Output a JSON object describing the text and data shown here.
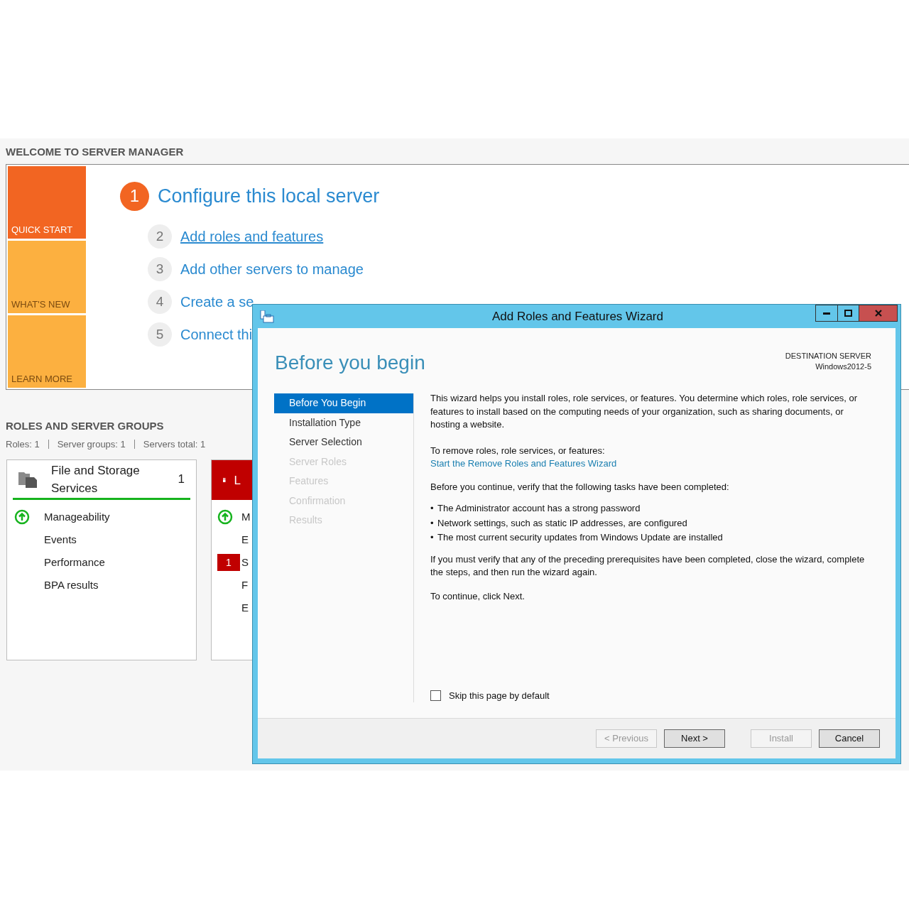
{
  "page_heading": "WELCOME TO SERVER MANAGER",
  "quick_start": {
    "tiles": [
      {
        "label": "QUICK START",
        "selected": true
      },
      {
        "label": "WHAT'S NEW",
        "selected": false
      },
      {
        "label": "LEARN MORE",
        "selected": false
      }
    ],
    "main_step": {
      "number": "1",
      "label": "Configure this local server"
    },
    "steps": [
      {
        "number": "2",
        "label": "Add roles and features",
        "underlined": true
      },
      {
        "number": "3",
        "label": "Add other servers to manage",
        "underlined": false
      },
      {
        "number": "4",
        "label": "Create a se",
        "underlined": false
      },
      {
        "number": "5",
        "label": "Connect thi",
        "underlined": false
      }
    ]
  },
  "roles": {
    "heading": "ROLES AND SERVER GROUPS",
    "summary": [
      "Roles: 1",
      "Server groups: 1",
      "Servers total: 1"
    ],
    "cards": [
      {
        "title": "File and Storage Services",
        "count": "1",
        "kind": "ok",
        "items": [
          {
            "label": "Manageability",
            "kind": "up"
          },
          {
            "label": "Events",
            "kind": "plain"
          },
          {
            "label": "Performance",
            "kind": "plain"
          },
          {
            "label": "BPA results",
            "kind": "plain"
          }
        ]
      },
      {
        "title": "L",
        "kind": "error",
        "items": [
          {
            "label": "M",
            "kind": "up"
          },
          {
            "label": "E",
            "kind": "plain"
          },
          {
            "label": "S",
            "kind": "badge",
            "badge": "1"
          },
          {
            "label": "F",
            "kind": "plain"
          },
          {
            "label": "E",
            "kind": "plain"
          }
        ]
      }
    ]
  },
  "wizard": {
    "title": "Add Roles and Features Wizard",
    "page_title": "Before you begin",
    "destination_label": "DESTINATION SERVER",
    "destination_value": "Windows2012-5",
    "nav": [
      {
        "label": "Before You Begin",
        "selected": true,
        "disabled": false
      },
      {
        "label": "Installation Type",
        "selected": false,
        "disabled": false
      },
      {
        "label": "Server Selection",
        "selected": false,
        "disabled": false
      },
      {
        "label": "Server Roles",
        "selected": false,
        "disabled": true
      },
      {
        "label": "Features",
        "selected": false,
        "disabled": true
      },
      {
        "label": "Confirmation",
        "selected": false,
        "disabled": true
      },
      {
        "label": "Results",
        "selected": false,
        "disabled": true
      }
    ],
    "intro": "This wizard helps you install roles, role services, or features. You determine which roles, role services, or features to install based on the computing needs of your organization, such as sharing documents, or hosting a website.",
    "remove_text": "To remove roles, role services, or features:",
    "remove_link": "Start the Remove Roles and Features Wizard",
    "verify_text": "Before you continue, verify that the following tasks have been completed:",
    "bullets": [
      "The Administrator account has a strong password",
      "Network settings, such as static IP addresses, are configured",
      "The most current security updates from Windows Update are installed"
    ],
    "bullet_mark": "•",
    "prereq_text": "If you must verify that any of the preceding prerequisites have been completed, close the wizard, complete the steps, and then run the wizard again.",
    "continue_text": "To continue, click Next.",
    "skip_checkbox": {
      "label": "Skip this page by default",
      "checked": false
    },
    "buttons": [
      {
        "label": "< Previous",
        "disabled": true
      },
      {
        "label": "Next >",
        "disabled": false
      },
      {
        "label": "Install",
        "disabled": true
      },
      {
        "label": "Cancel",
        "disabled": false
      }
    ]
  }
}
